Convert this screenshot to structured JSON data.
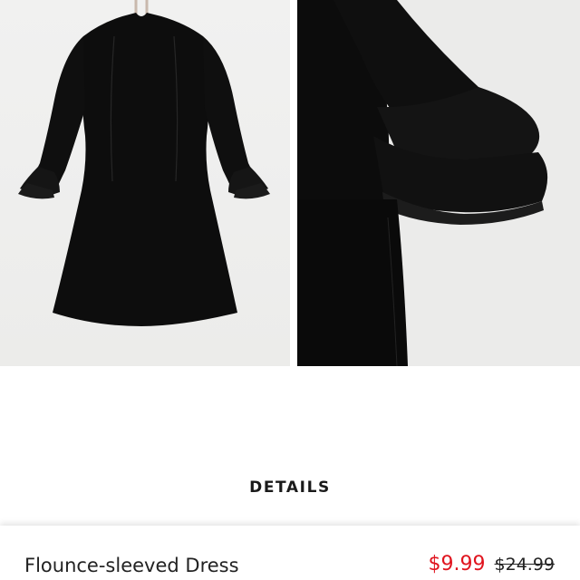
{
  "gallery": {
    "images": [
      {
        "label": "dress-front-view"
      },
      {
        "label": "sleeve-detail-view"
      }
    ]
  },
  "details": {
    "label": "DETAILS"
  },
  "product": {
    "name": "Flounce-sleeved Dress",
    "sale_price": "$9.99",
    "original_price": "$24.99"
  },
  "colors": {
    "sale": "#e0141e",
    "text": "#222222",
    "garment": "#0d0d0d",
    "background": "#ffffff"
  }
}
